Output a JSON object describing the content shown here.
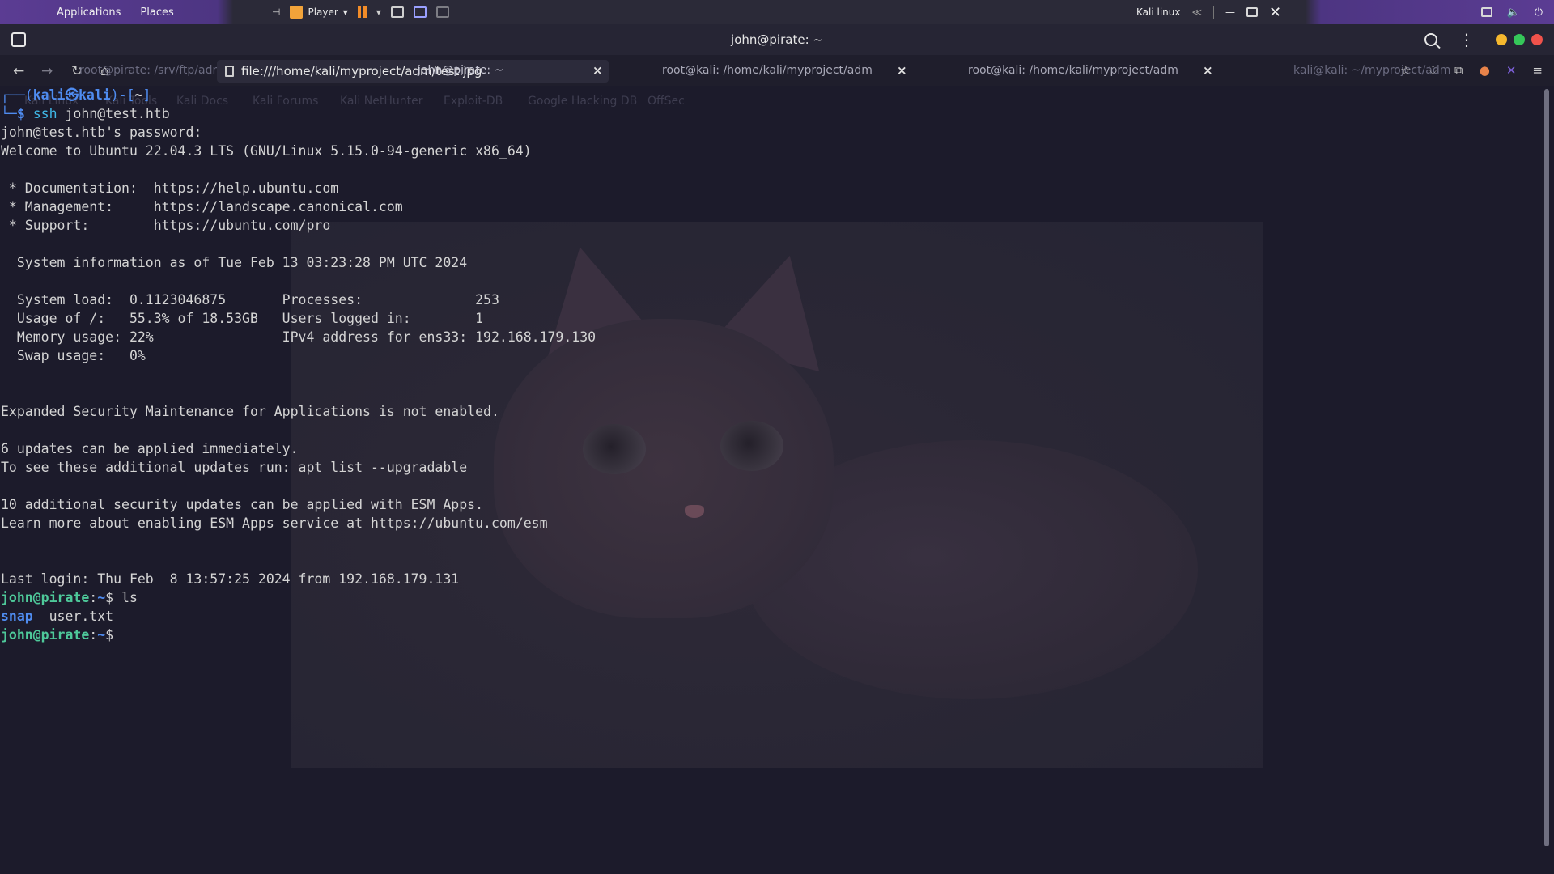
{
  "system_bar": {
    "menu_applications": "Applications",
    "menu_places": "Places",
    "player_label": "Player",
    "vm_name": "Kali linux"
  },
  "window": {
    "title": "john@pirate: ~"
  },
  "tabs": {
    "url": "file:///home/kali/myproject/adm/test.jpg",
    "ghost_tab_1": "root@pirate: /srv/ftp/admin",
    "active_tab": "john@pirate: ~",
    "tab_2": "root@kali: /home/kali/myproject/adm",
    "tab_3": "root@kali: /home/kali/myproject/adm",
    "ghost_tab_4": "kali@kali: ~/myproject/adm",
    "close_glyph": "×"
  },
  "bookmarks": [
    "Kali Linux",
    "Kali Tools",
    "Kali Docs",
    "Kali Forums",
    "Kali NetHunter",
    "Exploit-DB",
    "Google Hacking DB",
    "OffSec"
  ],
  "terminal": {
    "prompt_top": "┌──(",
    "prompt_user": "kali㉿kali",
    "prompt_mid": ")-[",
    "prompt_dir": "~",
    "prompt_end": "]",
    "prompt_bottom": "└─",
    "prompt_dollar": "$ ",
    "cmd_ssh_bin": "ssh",
    "cmd_ssh_arg": " john@test.htb",
    "lines": [
      "john@test.htb's password:",
      "Welcome to Ubuntu 22.04.3 LTS (GNU/Linux 5.15.0-94-generic x86_64)",
      "",
      " * Documentation:  https://help.ubuntu.com",
      " * Management:     https://landscape.canonical.com",
      " * Support:        https://ubuntu.com/pro",
      "",
      "  System information as of Tue Feb 13 03:23:28 PM UTC 2024",
      "",
      "  System load:  0.1123046875       Processes:              253",
      "  Usage of /:   55.3% of 18.53GB   Users logged in:        1",
      "  Memory usage: 22%                IPv4 address for ens33: 192.168.179.130",
      "  Swap usage:   0%",
      "",
      "",
      "Expanded Security Maintenance for Applications is not enabled.",
      "",
      "6 updates can be applied immediately.",
      "To see these additional updates run: apt list --upgradable",
      "",
      "10 additional security updates can be applied with ESM Apps.",
      "Learn more about enabling ESM Apps service at https://ubuntu.com/esm",
      "",
      "",
      "Last login: Thu Feb  8 13:57:25 2024 from 192.168.179.131"
    ],
    "remote_user": "john@pirate",
    "remote_sep": ":",
    "remote_dir": "~",
    "remote_dollar": "$ ",
    "cmd_ls": "ls",
    "ls_dir": "snap",
    "ls_file": "  user.txt"
  },
  "colors": {
    "terminal_bg": "#1c1b2b",
    "prompt_blue": "#4f8cf0",
    "user_green": "#4ec99a"
  }
}
